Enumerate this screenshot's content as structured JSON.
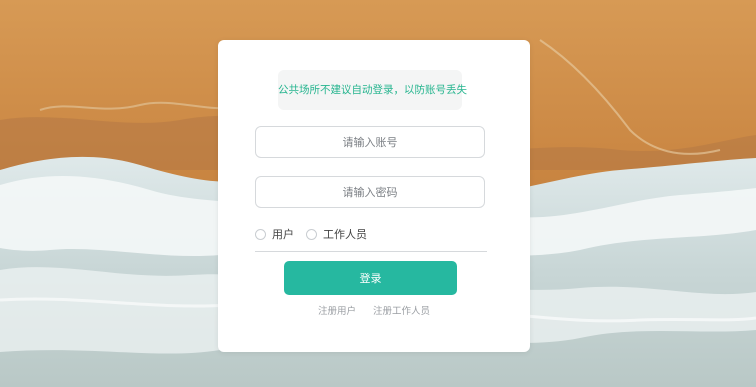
{
  "login": {
    "notice": "公共场所不建议自动登录，以防账号丢失",
    "account_placeholder": "请输入账号",
    "password_placeholder": "请输入密码",
    "roles": [
      "用户",
      "工作人员"
    ],
    "login_label": "登录",
    "register_user_label": "注册用户",
    "register_staff_label": "注册工作人员"
  },
  "theme": {
    "accent": "#26b8a0",
    "notice_text": "#26b58f",
    "sand": "#c98a48",
    "foam": "#eef3f3"
  }
}
